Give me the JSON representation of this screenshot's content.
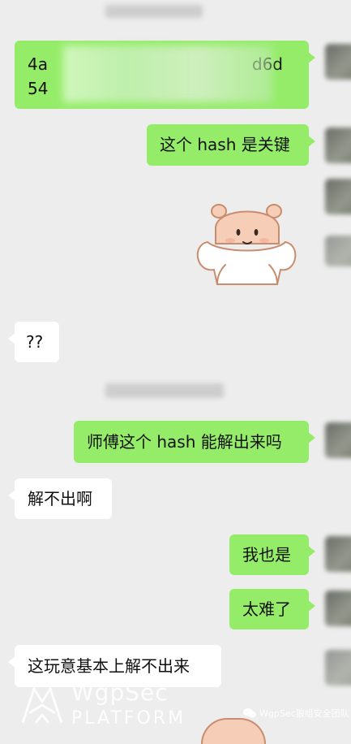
{
  "messages": [
    {
      "side": "right",
      "text_line1_start": "4a",
      "text_line1_end": "d6d",
      "text_line2_start": "54"
    },
    {
      "side": "right",
      "text": "这个 hash 是关键"
    },
    {
      "side": "right",
      "type": "sticker"
    },
    {
      "side": "left",
      "text": "??"
    },
    {
      "side": "right",
      "text": "师傅这个 hash 能解出来吗"
    },
    {
      "side": "left",
      "text": "解不出啊"
    },
    {
      "side": "right",
      "text": "我也是"
    },
    {
      "side": "right",
      "text": "太难了"
    },
    {
      "side": "left",
      "text": "这玩意基本上解不出来"
    }
  ],
  "watermark": {
    "brand_line1": "WgpSec",
    "brand_line2": "PLATFORM",
    "account": "WgpSec狼组安全团队"
  },
  "colors": {
    "background": "#ededed",
    "sent_bubble": "#95ec69",
    "received_bubble": "#ffffff"
  }
}
